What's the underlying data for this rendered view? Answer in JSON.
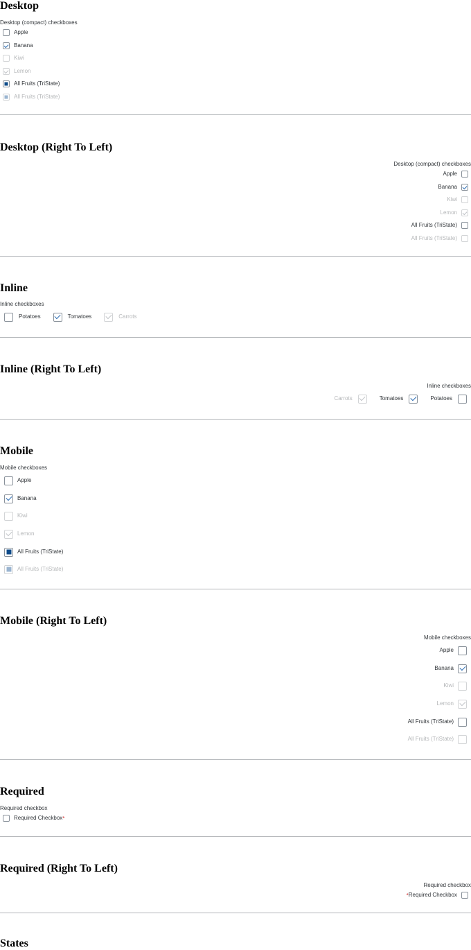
{
  "desktop": {
    "title": "Desktop",
    "caption": "Desktop (compact) checkboxes",
    "items": [
      {
        "label": "Apple",
        "state": "unchecked",
        "disabled": false
      },
      {
        "label": "Banana",
        "state": "checked",
        "disabled": false
      },
      {
        "label": "Kiwi",
        "state": "unchecked",
        "disabled": true
      },
      {
        "label": "Lemon",
        "state": "checked",
        "disabled": true
      },
      {
        "label": "All Fruits (TriState)",
        "state": "indeterminate",
        "disabled": false
      },
      {
        "label": "All Fruits (TriState)",
        "state": "indeterminate",
        "disabled": true
      }
    ]
  },
  "desktop_rtl": {
    "title": "Desktop (Right To Left)",
    "caption": "Desktop (compact) checkboxes",
    "items": [
      {
        "label": "Apple",
        "state": "unchecked",
        "disabled": false
      },
      {
        "label": "Banana",
        "state": "checked",
        "disabled": false
      },
      {
        "label": "Kiwi",
        "state": "unchecked",
        "disabled": true
      },
      {
        "label": "Lemon",
        "state": "checked",
        "disabled": true
      },
      {
        "label": "All Fruits (TriState)",
        "state": "unchecked",
        "disabled": false
      },
      {
        "label": "All Fruits (TriState)",
        "state": "unchecked",
        "disabled": true
      }
    ]
  },
  "inline": {
    "title": "Inline",
    "caption": "Inline checkboxes",
    "items": [
      {
        "label": "Potatoes",
        "state": "unchecked",
        "disabled": false
      },
      {
        "label": "Tomatoes",
        "state": "checked",
        "disabled": false
      },
      {
        "label": "Carrots",
        "state": "checked",
        "disabled": true
      }
    ]
  },
  "inline_rtl": {
    "title": "Inline (Right To Left)",
    "caption": "Inline checkboxes",
    "items": [
      {
        "label": "Potatoes",
        "state": "unchecked",
        "disabled": false
      },
      {
        "label": "Tomatoes",
        "state": "checked",
        "disabled": false
      },
      {
        "label": "Carrots",
        "state": "checked",
        "disabled": true
      }
    ]
  },
  "mobile": {
    "title": "Mobile",
    "caption": "Mobile checkboxes",
    "items": [
      {
        "label": "Apple",
        "state": "unchecked",
        "disabled": false
      },
      {
        "label": "Banana",
        "state": "checked",
        "disabled": false
      },
      {
        "label": "Kiwi",
        "state": "unchecked",
        "disabled": true
      },
      {
        "label": "Lemon",
        "state": "checked",
        "disabled": true
      },
      {
        "label": "All Fruits (TriState)",
        "state": "indeterminate",
        "disabled": false
      },
      {
        "label": "All Fruits (TriState)",
        "state": "indeterminate",
        "disabled": true
      }
    ]
  },
  "mobile_rtl": {
    "title": "Mobile (Right To Left)",
    "caption": "Mobile checkboxes",
    "items": [
      {
        "label": "Apple",
        "state": "unchecked",
        "disabled": false
      },
      {
        "label": "Banana",
        "state": "checked",
        "disabled": false
      },
      {
        "label": "Kiwi",
        "state": "unchecked",
        "disabled": true
      },
      {
        "label": "Lemon",
        "state": "checked",
        "disabled": true
      },
      {
        "label": "All Fruits (TriState)",
        "state": "unchecked",
        "disabled": false
      },
      {
        "label": "All Fruits (TriState)",
        "state": "unchecked",
        "disabled": true
      }
    ]
  },
  "required": {
    "title": "Required",
    "caption": "Required checkbox",
    "label": "Required Checkbox",
    "marker": "*"
  },
  "required_rtl": {
    "title": "Required (Right To Left)",
    "caption": "Required checkbox",
    "label": "Required Checkbox",
    "marker": "*"
  },
  "next_section": {
    "title": "States"
  },
  "colors": {
    "checkmark": "#2a6cb3",
    "tristate": "#0f4c8a",
    "required_marker": "#d32f2f",
    "divider": "#b2b5b8"
  }
}
